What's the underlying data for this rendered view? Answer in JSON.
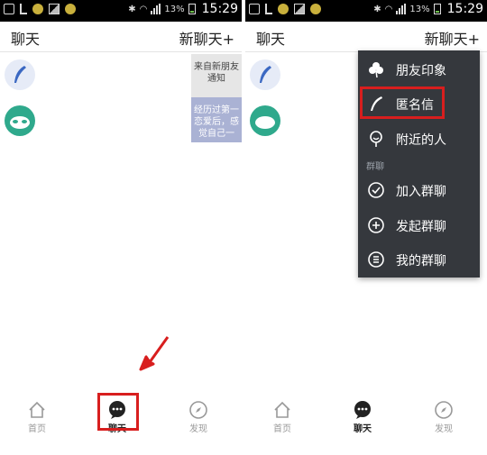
{
  "status_bar": {
    "battery": "13%",
    "time": "15:29"
  },
  "left_screen": {
    "header": {
      "title": "聊天",
      "action": "新聊天+"
    },
    "promos": [
      {
        "text": "来自新朋友通知"
      },
      {
        "text": "经历过第一恋爱后，感觉自己一"
      }
    ],
    "nav": {
      "home_label": "首页",
      "chat_label": "聊天",
      "discover_label": "发现"
    }
  },
  "right_screen": {
    "header": {
      "title": "聊天",
      "action": "新聊天+"
    },
    "menu": {
      "items": [
        {
          "label": "朋友印象",
          "icon": "clover-icon"
        },
        {
          "label": "匿名信",
          "icon": "feather-icon"
        },
        {
          "label": "附近的人",
          "icon": "location-pin-icon"
        }
      ],
      "section": "群聊",
      "group_items": [
        {
          "label": "加入群聊",
          "icon": "check-circle-icon"
        },
        {
          "label": "发起群聊",
          "icon": "plus-circle-icon"
        },
        {
          "label": "我的群聊",
          "icon": "list-circle-icon"
        }
      ]
    },
    "nav": {
      "home_label": "首页",
      "chat_label": "聊天",
      "discover_label": "发现"
    }
  },
  "colors": {
    "highlight": "#d81e1e",
    "menu_bg": "#35383d",
    "promo_blue": "#aab2d4"
  }
}
